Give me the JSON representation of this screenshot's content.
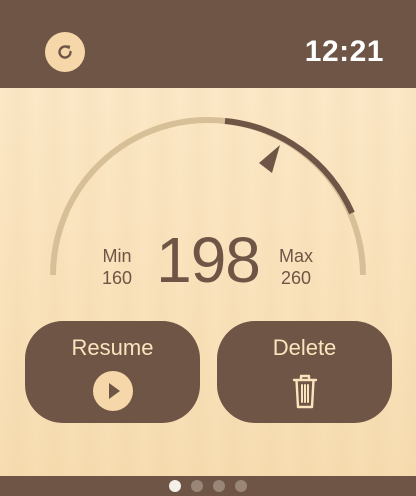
{
  "header": {
    "time": "12:21"
  },
  "gauge": {
    "current": "198",
    "min_label": "Min",
    "min_value": "160",
    "max_label": "Max",
    "max_value": "260"
  },
  "actions": {
    "resume_label": "Resume",
    "delete_label": "Delete"
  },
  "pager": {
    "page_count": 4,
    "active_index": 0
  },
  "colors": {
    "bar": "#6f5545",
    "accent": "#f6d7aa",
    "track": "#d7bf98",
    "background": "#fbe7c4"
  },
  "icons": {
    "refresh": "refresh-icon",
    "play": "play-icon",
    "trash": "trash-icon"
  }
}
